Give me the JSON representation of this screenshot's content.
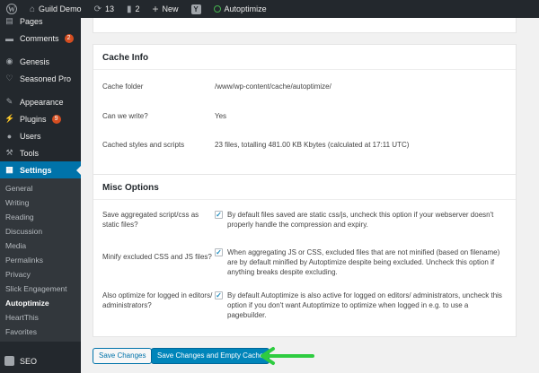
{
  "adminbar": {
    "site_name": "Guild Demo",
    "updates_count": "13",
    "comments_count": "2",
    "new_label": "New",
    "yoast_glyph": "Y",
    "plugin_label": "Autoptimize",
    "status_color": "#46b450"
  },
  "sidebar": {
    "items": [
      {
        "label": "Pages",
        "icon": "pages-icon"
      },
      {
        "label": "Comments",
        "icon": "comments-icon",
        "badge": "2"
      },
      {
        "label": "Genesis",
        "icon": "genesis-icon"
      },
      {
        "label": "Seasoned Pro",
        "icon": "heart-icon"
      },
      {
        "label": "Appearance",
        "icon": "appearance-icon"
      },
      {
        "label": "Plugins",
        "icon": "plugins-icon",
        "badge": "9"
      },
      {
        "label": "Users",
        "icon": "users-icon"
      },
      {
        "label": "Tools",
        "icon": "tools-icon"
      },
      {
        "label": "Settings",
        "icon": "settings-icon"
      }
    ],
    "submenu": [
      "General",
      "Writing",
      "Reading",
      "Discussion",
      "Media",
      "Permalinks",
      "Privacy",
      "Slick Engagement",
      "Autoptimize",
      "HeartThis",
      "Favorites"
    ],
    "seo_label": "SEO"
  },
  "cache_info": {
    "title": "Cache Info",
    "rows": [
      {
        "label": "Cache folder",
        "value": "/www/wp-content/cache/autoptimize/"
      },
      {
        "label": "Can we write?",
        "value": "Yes"
      },
      {
        "label": "Cached styles and scripts",
        "value": "23 files, totalling 481.00 KB Kbytes (calculated at 17:11 UTC)"
      }
    ]
  },
  "misc": {
    "title": "Misc Options",
    "options": [
      {
        "label": "Save aggregated script/css as static files?",
        "checked": true,
        "text": "By default files saved are static css/js, uncheck this option if your webserver doesn't properly handle the compression and expiry."
      },
      {
        "label": "Minify excluded CSS and JS files?",
        "checked": true,
        "text": "When aggregating JS or CSS, excluded files that are not minified (based on filename) are by default minified by Autoptimize despite being excluded. Uncheck this option if anything breaks despite excluding."
      },
      {
        "label": "Also optimize for logged in editors/ administrators?",
        "checked": true,
        "text": "By default Autoptimize is also active for logged on editors/ administrators, uncheck this option if you don't want Autoptimize to optimize when logged in e.g. to use a pagebuilder."
      }
    ]
  },
  "buttons": {
    "save": "Save Changes",
    "save_empty": "Save Changes and Empty Cache"
  },
  "colors": {
    "accent": "#0073aa",
    "primary_button": "#0085ba",
    "arrow": "#2ecc40",
    "badge": "#d54e21"
  },
  "checkmark": "✓"
}
